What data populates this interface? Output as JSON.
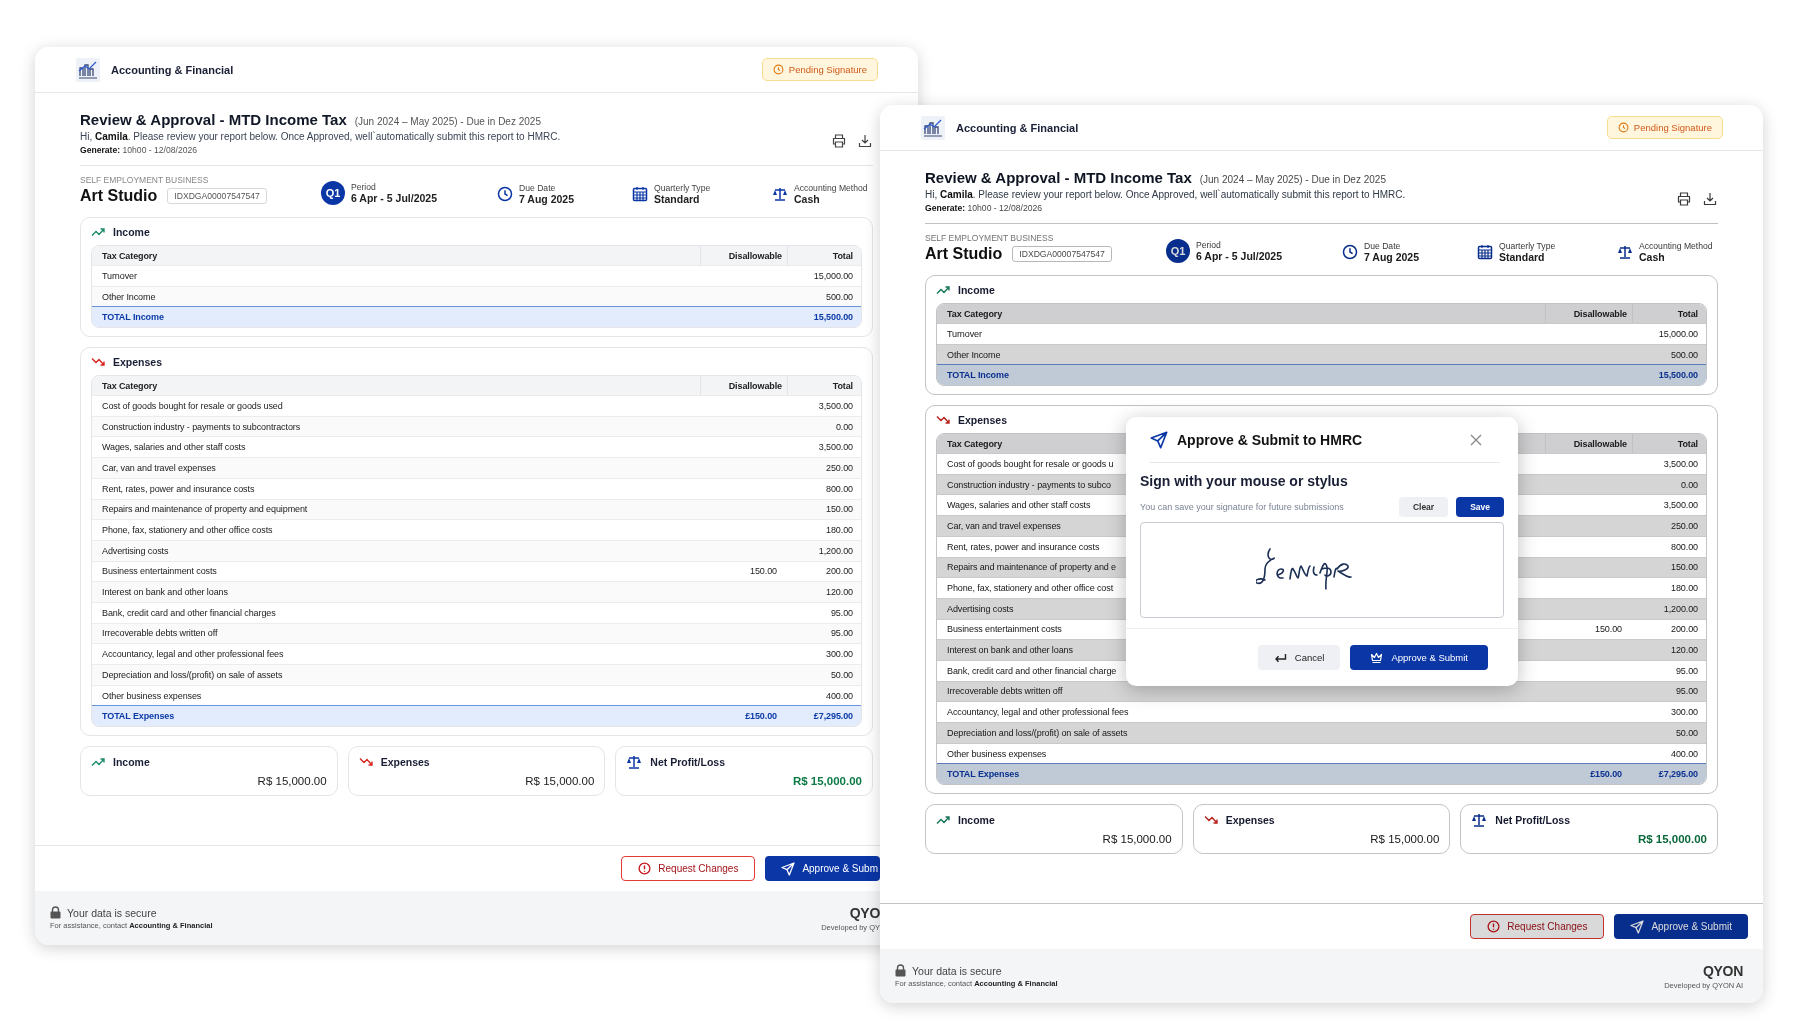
{
  "screens": [
    {
      "brand": "Accounting & Financial",
      "status_badge": "Pending Signature",
      "title": "Review & Approval - MTD Income Tax",
      "title_note": "(Jun 2024 – May 2025) - Due in Dez 2025",
      "greeting": "Hi, **Camila**. Please review your report below. Once Approved, well`automatically submit this report to HMRC.",
      "generated": "**Generate:** 10h00 - 12/08/2026",
      "dimmed": false,
      "business": {
        "label": "SELF EMPLOYMENT BUSINESS",
        "name": "Art Studio",
        "id": "IDXDGA00007547547"
      },
      "meta": [
        {
          "kind": "quarter",
          "badge": "Q1",
          "label": "Period",
          "value": "6 Apr - 5 Jul/2025"
        },
        {
          "kind": "due",
          "label": "Due Date",
          "value": "7 Aug 2025"
        },
        {
          "kind": "type",
          "label": "Quarterly Type",
          "value": "Standard"
        },
        {
          "kind": "method",
          "label": "Accounting Method",
          "value": "Cash"
        }
      ],
      "sections": [
        {
          "kind": "income",
          "title": "Income",
          "columns": [
            "Tax Category",
            "Disallowable",
            "Total"
          ],
          "rows": [
            {
              "category": "Turnover",
              "total": "15,000.00"
            },
            {
              "category": "Other Income",
              "total": "500.00"
            }
          ],
          "total": {
            "label": "TOTAL Income",
            "total": "15,500.00"
          }
        },
        {
          "kind": "expenses",
          "title": "Expenses",
          "columns": [
            "Tax Category",
            "Disallowable",
            "Total"
          ],
          "rows": [
            {
              "category": "Cost of goods bought for resale or goods used",
              "total": "3,500.00"
            },
            {
              "category": "Construction industry - payments to subcontractors",
              "total": "0.00"
            },
            {
              "category": "Wages, salaries and other staff costs",
              "total": "3,500.00"
            },
            {
              "category": "Car, van and travel expenses",
              "total": "250.00"
            },
            {
              "category": "Rent, rates, power and insurance costs",
              "total": "800.00"
            },
            {
              "category": "Repairs and maintenance of property and equipment",
              "total": "150.00"
            },
            {
              "category": "Phone, fax, stationery and other office costs",
              "total": "180.00"
            },
            {
              "category": "Advertising costs",
              "total": "1,200.00"
            },
            {
              "category": "Business entertainment costs",
              "disallowable": "150.00",
              "total": "200.00"
            },
            {
              "category": "Interest on bank and other loans",
              "total": "120.00"
            },
            {
              "category": "Bank, credit card and other financial charges",
              "total": "95.00"
            },
            {
              "category": "Irrecoverable debts written off",
              "total": "95.00"
            },
            {
              "category": "Accountancy, legal and other professional fees",
              "total": "300.00"
            },
            {
              "category": "Depreciation and loss/(profit) on sale of assets",
              "total": "50.00"
            },
            {
              "category": "Other business expenses",
              "total": "400.00"
            }
          ],
          "total": {
            "label": "TOTAL Expenses",
            "disallowable": "£150.00",
            "total": "£7,295.00"
          }
        }
      ],
      "summary": [
        {
          "kind": "income",
          "label": "Income",
          "value": "R$ 15,000.00"
        },
        {
          "kind": "expenses",
          "label": "Expenses",
          "value": "R$ 15,000.00"
        },
        {
          "kind": "net",
          "label": "Net Profit/Loss",
          "value": "R$ 15,000.00"
        }
      ],
      "actions": [
        {
          "kind": "secondary",
          "label": "Request Changes"
        },
        {
          "kind": "primary",
          "label": "Approve & Subm"
        }
      ],
      "footer": {
        "secure": "Your data is secure",
        "contact": "For assistance, contact **Accounting & Financial**",
        "brand": "QYO",
        "developer": "Developed by QY"
      }
    },
    {
      "brand": "Accounting & Financial",
      "status_badge": "Pending Signature",
      "title": "Review & Approval - MTD Income Tax",
      "title_note": "(Jun 2024 – May 2025) - Due in Dez 2025",
      "greeting": "Hi, **Camila**. Please review your report below. Once Approved, well`automatically submit this report to HMRC.",
      "generated": "**Generate:** 10h00 - 12/08/2026",
      "dimmed": true,
      "business": {
        "label": "SELF EMPLOYMENT BUSINESS",
        "name": "Art Studio",
        "id": "IDXDGA00007547547"
      },
      "meta": [
        {
          "kind": "quarter",
          "badge": "Q1",
          "label": "Period",
          "value": "6 Apr - 5 Jul/2025"
        },
        {
          "kind": "due",
          "label": "Due Date",
          "value": "7 Aug 2025"
        },
        {
          "kind": "type",
          "label": "Quarterly Type",
          "value": "Standard"
        },
        {
          "kind": "method",
          "label": "Accounting Method",
          "value": "Cash"
        }
      ],
      "sections": [
        {
          "kind": "income",
          "title": "Income",
          "columns": [
            "Tax Category",
            "Disallowable",
            "Total"
          ],
          "rows": [
            {
              "category": "Turnover",
              "total": "15,000.00"
            },
            {
              "category": "Other Income",
              "total": "500.00"
            }
          ],
          "total": {
            "label": "TOTAL Income",
            "total": "15,500.00"
          }
        },
        {
          "kind": "expenses",
          "title": "Expenses",
          "columns": [
            "Tax Category",
            "Disallowable",
            "Total"
          ],
          "rows": [
            {
              "category": "Cost of goods bought for resale or goods u",
              "total": "3,500.00"
            },
            {
              "category": "Construction industry - payments to subco",
              "total": "0.00"
            },
            {
              "category": "Wages, salaries and other staff costs",
              "total": "3,500.00"
            },
            {
              "category": "Car, van and travel expenses",
              "total": "250.00"
            },
            {
              "category": "Rent, rates, power and insurance costs",
              "total": "800.00"
            },
            {
              "category": "Repairs and maintenance of property and e",
              "total": "150.00"
            },
            {
              "category": "Phone, fax, stationery and other office cost",
              "total": "180.00"
            },
            {
              "category": "Advertising costs",
              "total": "1,200.00"
            },
            {
              "category": "Business entertainment costs",
              "disallowable": "150.00",
              "total": "200.00"
            },
            {
              "category": "Interest on bank and other loans",
              "total": "120.00"
            },
            {
              "category": "Bank, credit card and other financial charge",
              "total": "95.00"
            },
            {
              "category": "Irrecoverable debts written off",
              "total": "95.00"
            },
            {
              "category": "Accountancy, legal and other professional fees",
              "total": "300.00"
            },
            {
              "category": "Depreciation and loss/(profit) on sale of assets",
              "total": "50.00"
            },
            {
              "category": "Other business expenses",
              "total": "400.00"
            }
          ],
          "total": {
            "label": "TOTAL Expenses",
            "disallowable": "£150.00",
            "total": "£7,295.00"
          }
        }
      ],
      "summary": [
        {
          "kind": "income",
          "label": "Income",
          "value": "R$ 15,000.00"
        },
        {
          "kind": "expenses",
          "label": "Expenses",
          "value": "R$ 15,000.00"
        },
        {
          "kind": "net",
          "label": "Net Profit/Loss",
          "value": "R$ 15,000.00"
        }
      ],
      "actions": [
        {
          "kind": "secondary",
          "label": "Request Changes"
        },
        {
          "kind": "primary",
          "label": "Approve & Submit"
        }
      ],
      "footer": {
        "secure": "Your data is secure",
        "contact": "For assistance, contact **Accounting & Financial**",
        "brand": "QYON",
        "developer": "Developed by QYON AI"
      },
      "modal": {
        "title": "Approve & Submit to HMRC",
        "heading": "Sign with your mouse or stylus",
        "hint": "You can save your signature for future submissions",
        "tools": [
          {
            "kind": "secondary",
            "label": "Clear"
          },
          {
            "kind": "primary",
            "label": "Save"
          }
        ],
        "actions": [
          {
            "kind": "cancel",
            "label": "Cancel"
          },
          {
            "kind": "submit",
            "label": "Approve & Submit"
          }
        ]
      }
    }
  ]
}
